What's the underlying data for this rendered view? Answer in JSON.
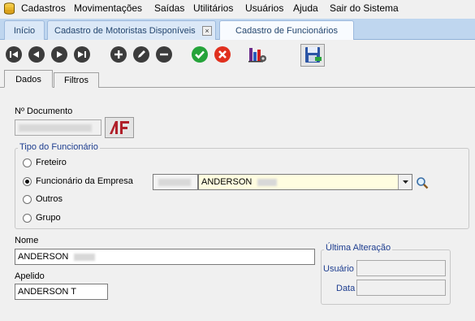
{
  "menu": {
    "app_icon": "database-stack-icon",
    "items": [
      {
        "label": "Cadastros"
      },
      {
        "label": "Movimentações"
      },
      {
        "label": "Saídas"
      },
      {
        "label": "Utilitários"
      },
      {
        "label": "Usuários"
      },
      {
        "label": "Ajuda"
      },
      {
        "label": "Sair do Sistema"
      }
    ]
  },
  "tabs": [
    {
      "label": "Início",
      "active": false
    },
    {
      "label": "Cadastro de Motoristas Disponíveis",
      "active": false,
      "close_icon": "close-icon"
    },
    {
      "label": "Cadastro de Funcionários",
      "active": true
    }
  ],
  "toolbar": {
    "first": "first-record-icon",
    "prev": "previous-record-icon",
    "next": "next-record-icon",
    "last": "last-record-icon",
    "add": "add-icon",
    "edit": "edit-pencil-icon",
    "remove": "remove-icon",
    "confirm": "confirm-check-icon",
    "cancel": "cancel-x-icon",
    "report": "report-chart-icon",
    "save": "save-disk-icon"
  },
  "page_tabs": [
    {
      "label": "Dados",
      "active": true
    },
    {
      "label": "Filtros",
      "active": false
    }
  ],
  "form": {
    "documento_label": "Nº Documento",
    "documento_value": "",
    "tipo_group_title": "Tipo do Funcionário",
    "radios": [
      {
        "label": "Freteiro",
        "checked": false
      },
      {
        "label": "Funcionário da Empresa",
        "checked": true
      },
      {
        "label": "Outros",
        "checked": false
      },
      {
        "label": "Grupo",
        "checked": false
      }
    ],
    "empresa_code": "",
    "empresa_name": "ANDERSON",
    "nome_label": "Nome",
    "nome_value": "ANDERSON",
    "apelido_label": "Apelido",
    "apelido_value": "ANDERSON T",
    "ultima_group_title": "Última Alteração",
    "usuario_label": "Usuário",
    "usuario_value": "",
    "data_label": "Data",
    "data_value": ""
  },
  "colors": {
    "tab_strip": "#bfd6ef",
    "group_title": "#1d3d8f",
    "combo_bg": "#fffde0",
    "confirm": "#25a33a",
    "cancel": "#e0301e"
  }
}
